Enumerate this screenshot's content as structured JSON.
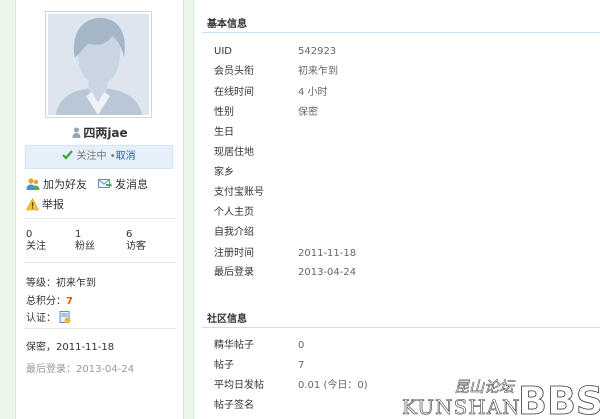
{
  "profile": {
    "username": "四两jae",
    "follow_status": "关注中",
    "follow_sep": "•",
    "follow_cancel": "取消",
    "add_friend": "加为好友",
    "send_message": "发消息",
    "report": "举报",
    "stats": [
      {
        "count": "0",
        "label": "关注"
      },
      {
        "count": "1",
        "label": "粉丝"
      },
      {
        "count": "6",
        "label": "访客"
      }
    ],
    "level_label": "等级：",
    "level_value": "初来乍到",
    "points_label": "总积分：",
    "points_value": "7",
    "verify_label": "认证：",
    "gender_reg": "保密，2011-11-18",
    "last_login_line": "最后登录：2013-04-24"
  },
  "basic_info": {
    "title": "基本信息",
    "rows": [
      {
        "label": "UID",
        "value": "542923"
      },
      {
        "label": "会员头衔",
        "value": "初来乍到"
      },
      {
        "label": "在线时间",
        "value": "4 小时"
      },
      {
        "label": "性别",
        "value": "保密"
      },
      {
        "label": "生日",
        "value": ""
      },
      {
        "label": "现居住地",
        "value": ""
      },
      {
        "label": "家乡",
        "value": ""
      },
      {
        "label": "支付宝账号",
        "value": ""
      },
      {
        "label": "个人主页",
        "value": ""
      },
      {
        "label": "自我介绍",
        "value": ""
      },
      {
        "label": "注册时间",
        "value": "2011-11-18"
      },
      {
        "label": "最后登录",
        "value": "2013-04-24"
      }
    ]
  },
  "community_info": {
    "title": "社区信息",
    "rows": [
      {
        "label": "精华帖子",
        "value": "0"
      },
      {
        "label": "帖子",
        "value": "7"
      },
      {
        "label": "平均日发帖",
        "value": "0.01 (今日：0)"
      },
      {
        "label": "帖子签名",
        "value": ""
      }
    ]
  },
  "watermark": {
    "cn": "昆山论坛",
    "en": "KUNSHAN",
    "bbs": "BBS"
  },
  "colors": {
    "accent_blue": "#2a5db0",
    "points_orange": "#e05a00",
    "check_green": "#3aa53a",
    "side_bg": "#eaf6ea"
  }
}
